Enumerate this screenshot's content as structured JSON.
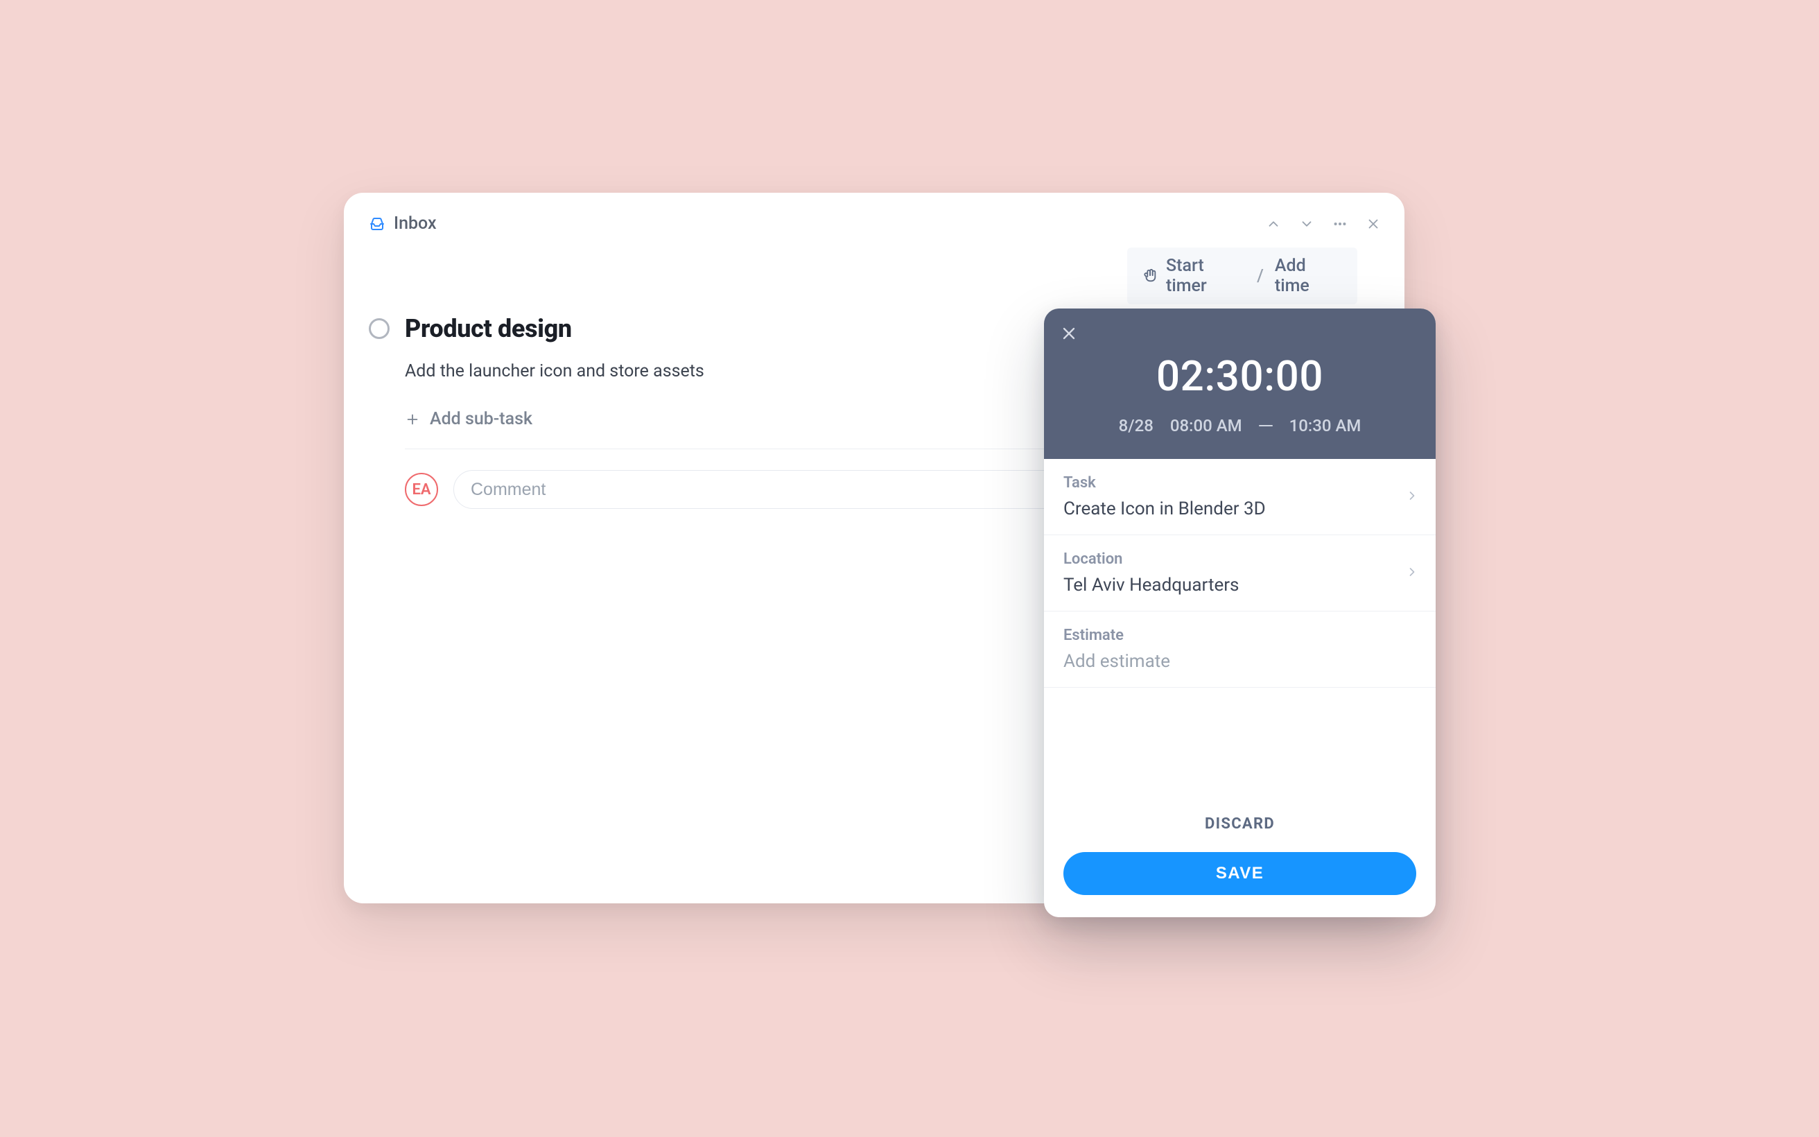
{
  "header": {
    "crumb": "Inbox"
  },
  "timer_bar": {
    "start": "Start timer",
    "separator": "/",
    "add": "Add time"
  },
  "task": {
    "title": "Product design",
    "description": "Add the launcher icon and store assets",
    "add_subtask": "Add sub-task",
    "comment_placeholder": "Comment",
    "avatar_initials": "EA"
  },
  "panel": {
    "duration": "02:30:00",
    "date": "8/28",
    "start_time": "08:00 AM",
    "end_time": "10:30 AM",
    "task_label": "Task",
    "task_value": "Create Icon in Blender 3D",
    "location_label": "Location",
    "location_value": "Tel Aviv Headquarters",
    "estimate_label": "Estimate",
    "estimate_placeholder": "Add estimate",
    "discard": "DISCARD",
    "save": "SAVE"
  }
}
